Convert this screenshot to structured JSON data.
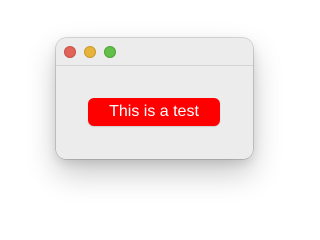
{
  "window": {
    "controls": [
      {
        "name": "close-button",
        "color": "#e0645a",
        "border": "#c85047"
      },
      {
        "name": "minimize-button",
        "color": "#e6b43a",
        "border": "#c99a2b"
      },
      {
        "name": "zoom-button",
        "color": "#62c048",
        "border": "#4fa336"
      }
    ]
  },
  "main": {
    "button_label": "This is a test",
    "button_color": "#ff0000"
  }
}
